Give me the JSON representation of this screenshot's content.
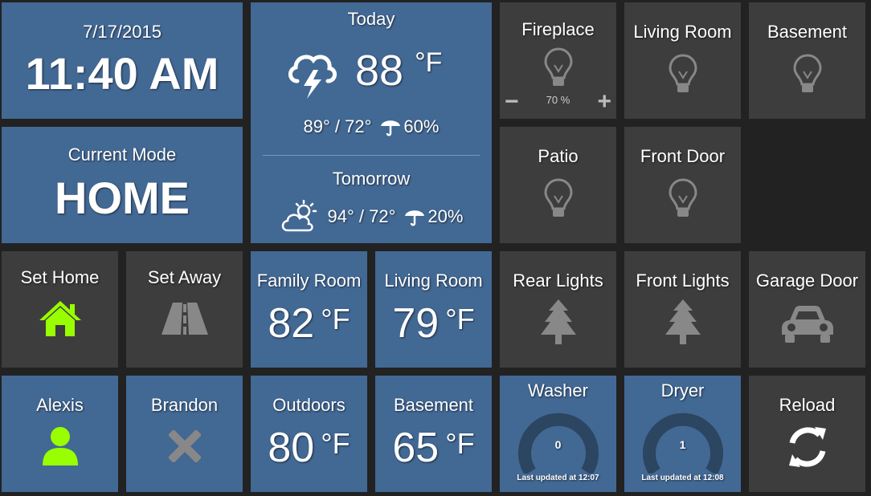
{
  "clock": {
    "date": "7/17/2015",
    "time": "11:40 AM"
  },
  "mode": {
    "label": "Current Mode",
    "value": "HOME"
  },
  "weather": {
    "today_label": "Today",
    "today_temp": "88",
    "today_unit": "°F",
    "today_hilo": "89° / 72°",
    "today_precip": "60%",
    "tomorrow_label": "Tomorrow",
    "tomorrow_hilo": "94° / 72°",
    "tomorrow_precip": "20%"
  },
  "lights": {
    "fireplace": {
      "label": "Fireplace",
      "level": "70 %",
      "minus": "−",
      "plus": "+"
    },
    "living_room": {
      "label": "Living Room"
    },
    "basement": {
      "label": "Basement"
    },
    "patio": {
      "label": "Patio"
    },
    "front_door": {
      "label": "Front Door"
    }
  },
  "modes": {
    "set_home": {
      "label": "Set Home"
    },
    "set_away": {
      "label": "Set Away"
    }
  },
  "temps": {
    "family_room": {
      "label": "Family Room",
      "value": "82",
      "unit": "°F"
    },
    "living_room": {
      "label": "Living Room",
      "value": "79",
      "unit": "°F"
    },
    "outdoors": {
      "label": "Outdoors",
      "value": "80",
      "unit": "°F"
    },
    "basement": {
      "label": "Basement",
      "value": "65",
      "unit": "°F"
    }
  },
  "switches": {
    "rear_lights": {
      "label": "Rear Lights"
    },
    "front_lights": {
      "label": "Front Lights"
    },
    "garage_door": {
      "label": "Garage Door"
    }
  },
  "presence": {
    "alexis": {
      "label": "Alexis",
      "present": true
    },
    "brandon": {
      "label": "Brandon",
      "present": false
    }
  },
  "appliances": {
    "washer": {
      "label": "Washer",
      "value": "0",
      "updated": "Last updated at 12:07"
    },
    "dryer": {
      "label": "Dryer",
      "value": "1",
      "updated": "Last updated at 12:08"
    }
  },
  "reload": {
    "label": "Reload"
  },
  "colors": {
    "blue_tile": "#426894",
    "gray_tile": "#3d3d3d",
    "background": "#222222",
    "accent_green": "#99ff00",
    "icon_gray": "#888888",
    "gauge_track": "#2c4560"
  },
  "icons": {
    "clock": "none",
    "weather_today": "thunderstorm-icon",
    "weather_tomorrow": "partly-sunny-icon",
    "precip": "umbrella-icon",
    "light": "lightbulb-icon",
    "set_home": "home-icon",
    "set_away": "road-icon",
    "switch": "tree-icon",
    "garage": "car-icon",
    "present": "user-icon",
    "absent": "x-icon",
    "reload": "refresh-icon"
  }
}
